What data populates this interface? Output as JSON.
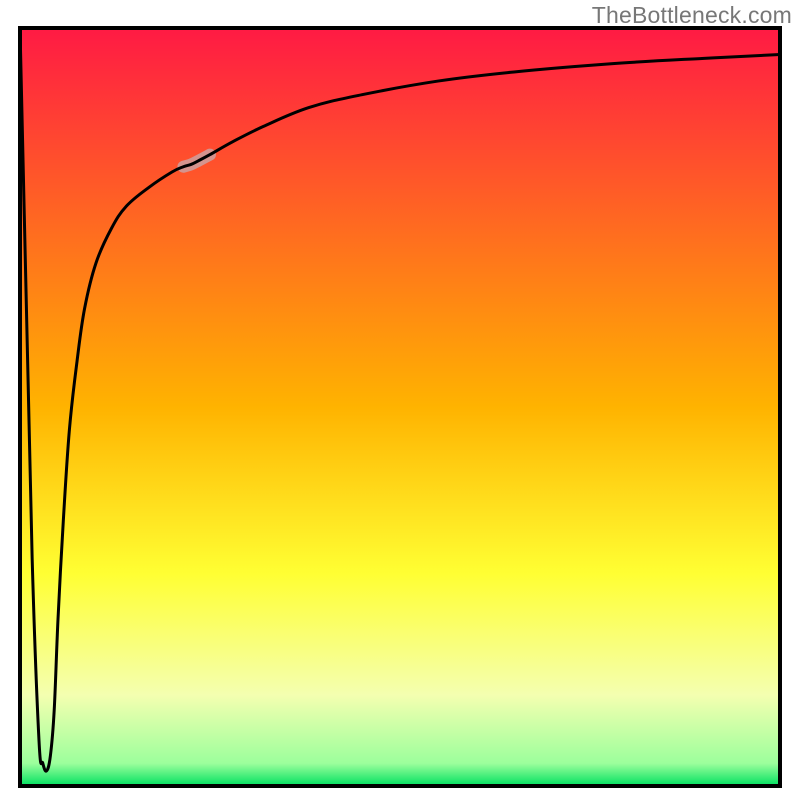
{
  "watermark": "TheBottleneck.com",
  "chart_data": {
    "type": "line",
    "title": "",
    "xlabel": "",
    "ylabel": "",
    "xlim": [
      0,
      100
    ],
    "ylim": [
      0,
      100
    ],
    "background_gradient": {
      "stops": [
        {
          "pos": 0.0,
          "color": "#ff1a44"
        },
        {
          "pos": 0.5,
          "color": "#ffb300"
        },
        {
          "pos": 0.72,
          "color": "#ffff33"
        },
        {
          "pos": 0.88,
          "color": "#f4ffb0"
        },
        {
          "pos": 0.97,
          "color": "#9cff9c"
        },
        {
          "pos": 1.0,
          "color": "#00e060"
        }
      ]
    },
    "series": [
      {
        "name": "bottleneck-curve",
        "x": [
          0.0,
          0.8,
          1.6,
          2.5,
          3.0,
          3.5,
          4.0,
          4.5,
          5.0,
          5.7,
          6.5,
          7.5,
          8.5,
          10.0,
          12.0,
          14.0,
          17.0,
          20.0,
          21.5,
          22.5,
          23.5,
          25.0,
          28.0,
          32.0,
          38.0,
          45.0,
          55.0,
          65.0,
          78.0,
          90.0,
          100.0
        ],
        "y": [
          100.0,
          65.0,
          30.0,
          6.0,
          3.0,
          2.0,
          4.0,
          10.0,
          22.0,
          35.0,
          47.0,
          56.0,
          63.0,
          69.0,
          73.5,
          76.5,
          79.0,
          81.0,
          81.7,
          82.0,
          82.5,
          83.3,
          85.0,
          87.0,
          89.5,
          91.2,
          93.0,
          94.2,
          95.3,
          96.0,
          96.5
        ]
      }
    ],
    "highlight_segment": {
      "x_start": 21.5,
      "x_end": 25.0,
      "color": "#cda0a0",
      "width": 12
    }
  },
  "frame": {
    "stroke": "#000000",
    "stroke_width": 4
  },
  "curve_style": {
    "stroke": "#000000",
    "stroke_width": 3
  }
}
